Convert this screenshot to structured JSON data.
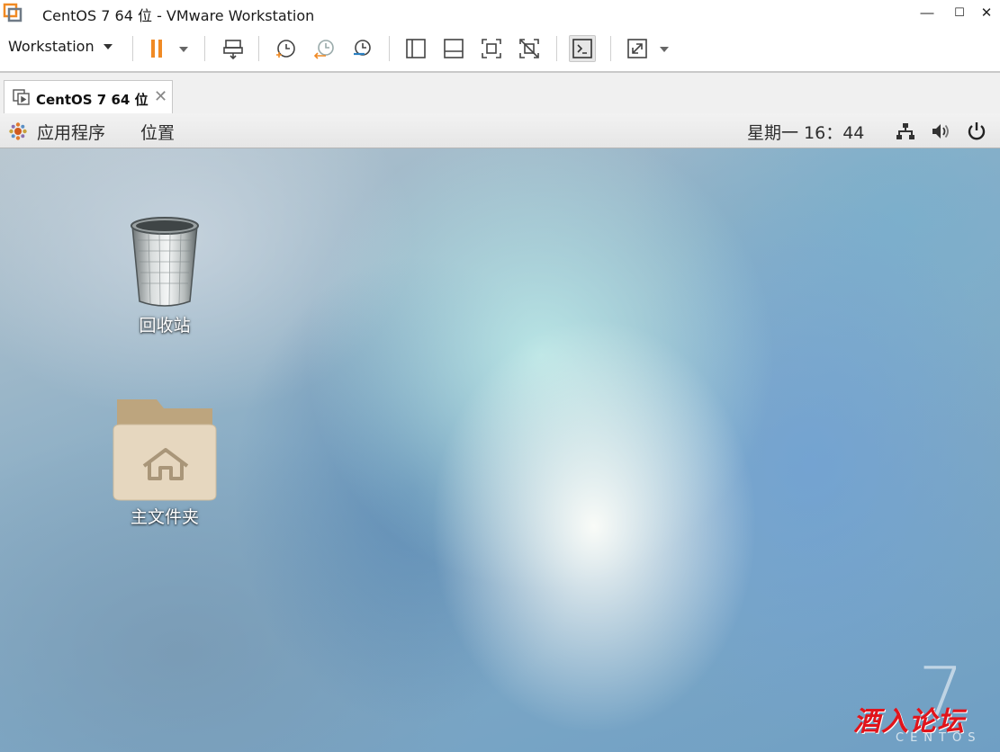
{
  "window": {
    "title": "CentOS 7 64 位 - VMware Workstation",
    "controls": {
      "minimize": "—",
      "maximize": "☐",
      "close": "✕"
    }
  },
  "toolbar": {
    "workstation_menu": "Workstation",
    "buttons": [
      "pause-icon",
      "send-ctrl-alt-del-icon",
      "snapshot-take-icon",
      "snapshot-revert-icon",
      "snapshot-manager-icon",
      "show-library-icon",
      "thumbnail-bar-icon",
      "full-screen-icon",
      "unity-icon",
      "console-view-icon",
      "stretch-guest-icon"
    ],
    "accent_color": "#f08a24"
  },
  "tabs": [
    {
      "label": "CentOS 7 64 位",
      "close": "✕",
      "active": true
    }
  ],
  "gnome_panel": {
    "applications": "应用程序",
    "places": "位置",
    "clock": "星期一 16：44",
    "indicators": [
      "network-icon",
      "volume-icon",
      "power-icon"
    ]
  },
  "desktop": {
    "icons": [
      {
        "label": "回收站",
        "icon": "trash-icon"
      },
      {
        "label": "主文件夹",
        "icon": "home-folder-icon"
      }
    ],
    "branding_number": "7",
    "branding_word": "CENTOS",
    "watermark": "酒入论坛",
    "watermark_color": "#e1141b"
  }
}
